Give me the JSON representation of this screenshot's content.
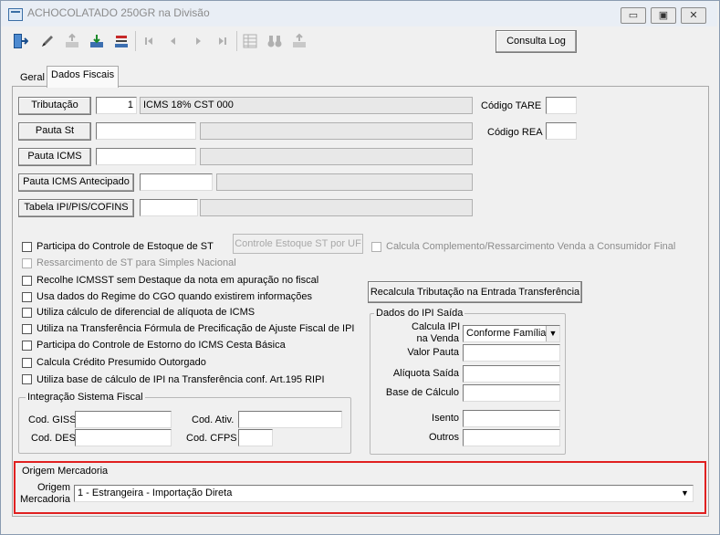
{
  "window": {
    "title": "ACHOCOLATADO 250GR na Divisão",
    "minimize": "▭",
    "maximize": "▣",
    "close": "✕"
  },
  "toolbar": {
    "consulta_log": "Consulta Log"
  },
  "tabs": [
    {
      "label": "Geral"
    },
    {
      "label": "Dados Fiscais"
    }
  ],
  "fiscal": {
    "tributacao": {
      "label": "Tributação",
      "code": "1",
      "desc": "ICMS 18% CST 000"
    },
    "pauta_st": {
      "label": "Pauta St"
    },
    "pauta_icms": {
      "label": "Pauta ICMS"
    },
    "pauta_icms_antecipado": {
      "label": "Pauta ICMS Antecipado"
    },
    "tabela_ipi": {
      "label": "Tabela IPI/PIS/COFINS"
    },
    "codigo_tare": "Código TARE",
    "codigo_rea": "Código REA"
  },
  "checks": [
    {
      "label": "Participa do Controle de Estoque de ST",
      "checked": false,
      "disabled": false
    },
    {
      "label": "Ressarcimento de ST para Simples Nacional",
      "checked": false,
      "disabled": true
    },
    {
      "label": "Recolhe ICMSST sem Destaque da nota em apuração no fiscal",
      "checked": false,
      "disabled": false
    },
    {
      "label": "Usa dados do Regime do CGO quando existirem informações",
      "checked": false,
      "disabled": false
    },
    {
      "label": "Utiliza cálculo de diferencial de alíquota de ICMS",
      "checked": false,
      "disabled": false
    },
    {
      "label": "Utiliza na Transferência  Fórmula de Precificação de Ajuste Fiscal de IPI",
      "checked": false,
      "disabled": false
    },
    {
      "label": "Participa do Controle de Estorno do ICMS Cesta Básica",
      "checked": false,
      "disabled": false
    },
    {
      "label": "Calcula Crédito Presumido Outorgado",
      "checked": false,
      "disabled": false
    },
    {
      "label": "Utiliza base de cálculo de IPI na Transferência conf. Art.195 RIPI",
      "checked": false,
      "disabled": false
    }
  ],
  "controle_estoque_st_button": "Controle Estoque ST por UF",
  "calcula_complemento": "Calcula Complemento/Ressarcimento Venda a Consumidor Final",
  "recalcula_button": "Recalcula Tributação na Entrada Transferência",
  "ipi_saida": {
    "title": "Dados do IPI Saída",
    "calcula_ipi_l1": "Calcula IPI",
    "calcula_ipi_l2": "na Venda",
    "calcula_ipi_value": "Conforme Família",
    "valor_pauta": "Valor Pauta",
    "aliquota_saida": "Alíquota Saída",
    "base_calculo": "Base de Cálculo",
    "isento": "Isento",
    "outros": "Outros"
  },
  "integracao": {
    "title": "Integração Sistema Fiscal",
    "cod_giss": "Cod. GISS",
    "cod_ativ": "Cod. Ativ.",
    "cod_des": "Cod. DES",
    "cod_cfps": "Cod. CFPS"
  },
  "origem": {
    "title": "Origem Mercadoria",
    "label_l1": "Origem",
    "label_l2": "Mercadoria",
    "value": "1 - Estrangeira - Importação Direta"
  },
  "icons": {
    "exit": "exit-door-icon",
    "edit": "pencil-icon",
    "add": "add-icon",
    "save": "save-icon",
    "cancel": "cancel-icon",
    "first": "first-record-icon",
    "prev": "prev-record-icon",
    "next": "next-record-icon",
    "last": "last-record-icon",
    "grid": "grid-icon",
    "find": "binoculars-icon",
    "print": "print-icon"
  },
  "colors": {
    "highlight": "#e02020"
  }
}
